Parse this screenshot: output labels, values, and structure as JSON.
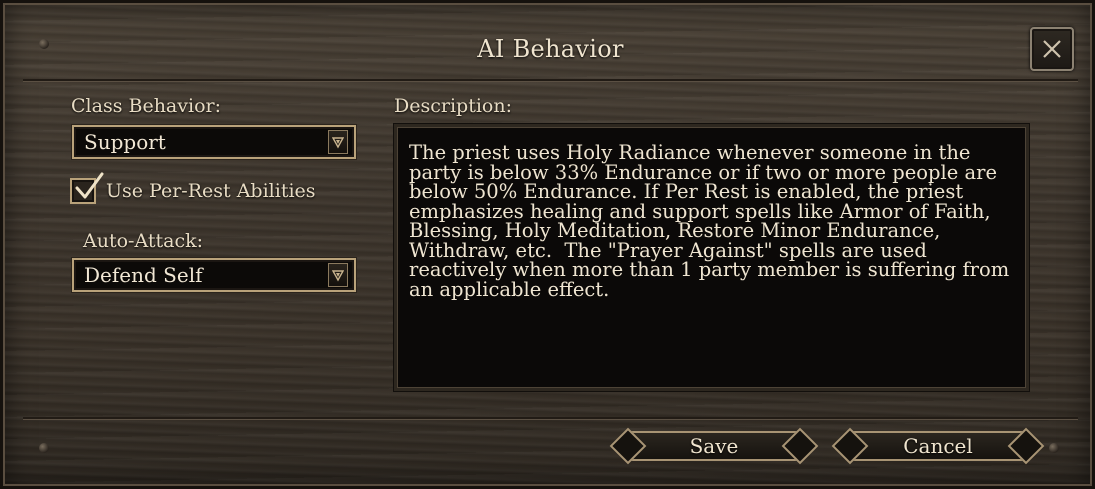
{
  "dialog": {
    "title": "AI Behavior"
  },
  "class_behavior": {
    "label": "Class Behavior:",
    "selected": "Support"
  },
  "per_rest": {
    "label": "Use Per-Rest Abilities",
    "checked": true
  },
  "auto_attack": {
    "label": "Auto-Attack:",
    "selected": "Defend Self"
  },
  "description": {
    "label": "Description:",
    "text": "The priest uses Holy Radiance whenever someone in the\nparty is below 33% Endurance or if two or more people are\nbelow 50% Endurance. If Per Rest is enabled, the priest\nemphasizes healing and support spells like Armor of Faith,\nBlessing, Holy Meditation, Restore Minor Endurance,\nWithdraw, etc.  The \"Prayer Against\" spells are used\nreactively when more than 1 party member is suffering from\nan applicable effect."
  },
  "buttons": {
    "save": "Save",
    "cancel": "Cancel"
  },
  "icons": {
    "close": "close-icon",
    "dropdown": "dropdown-arrow-icon",
    "check": "checkmark-icon"
  },
  "colors": {
    "text": "#e8dcc4",
    "border_gold": "#b9a27a",
    "panel_bg": "#0b0908"
  }
}
